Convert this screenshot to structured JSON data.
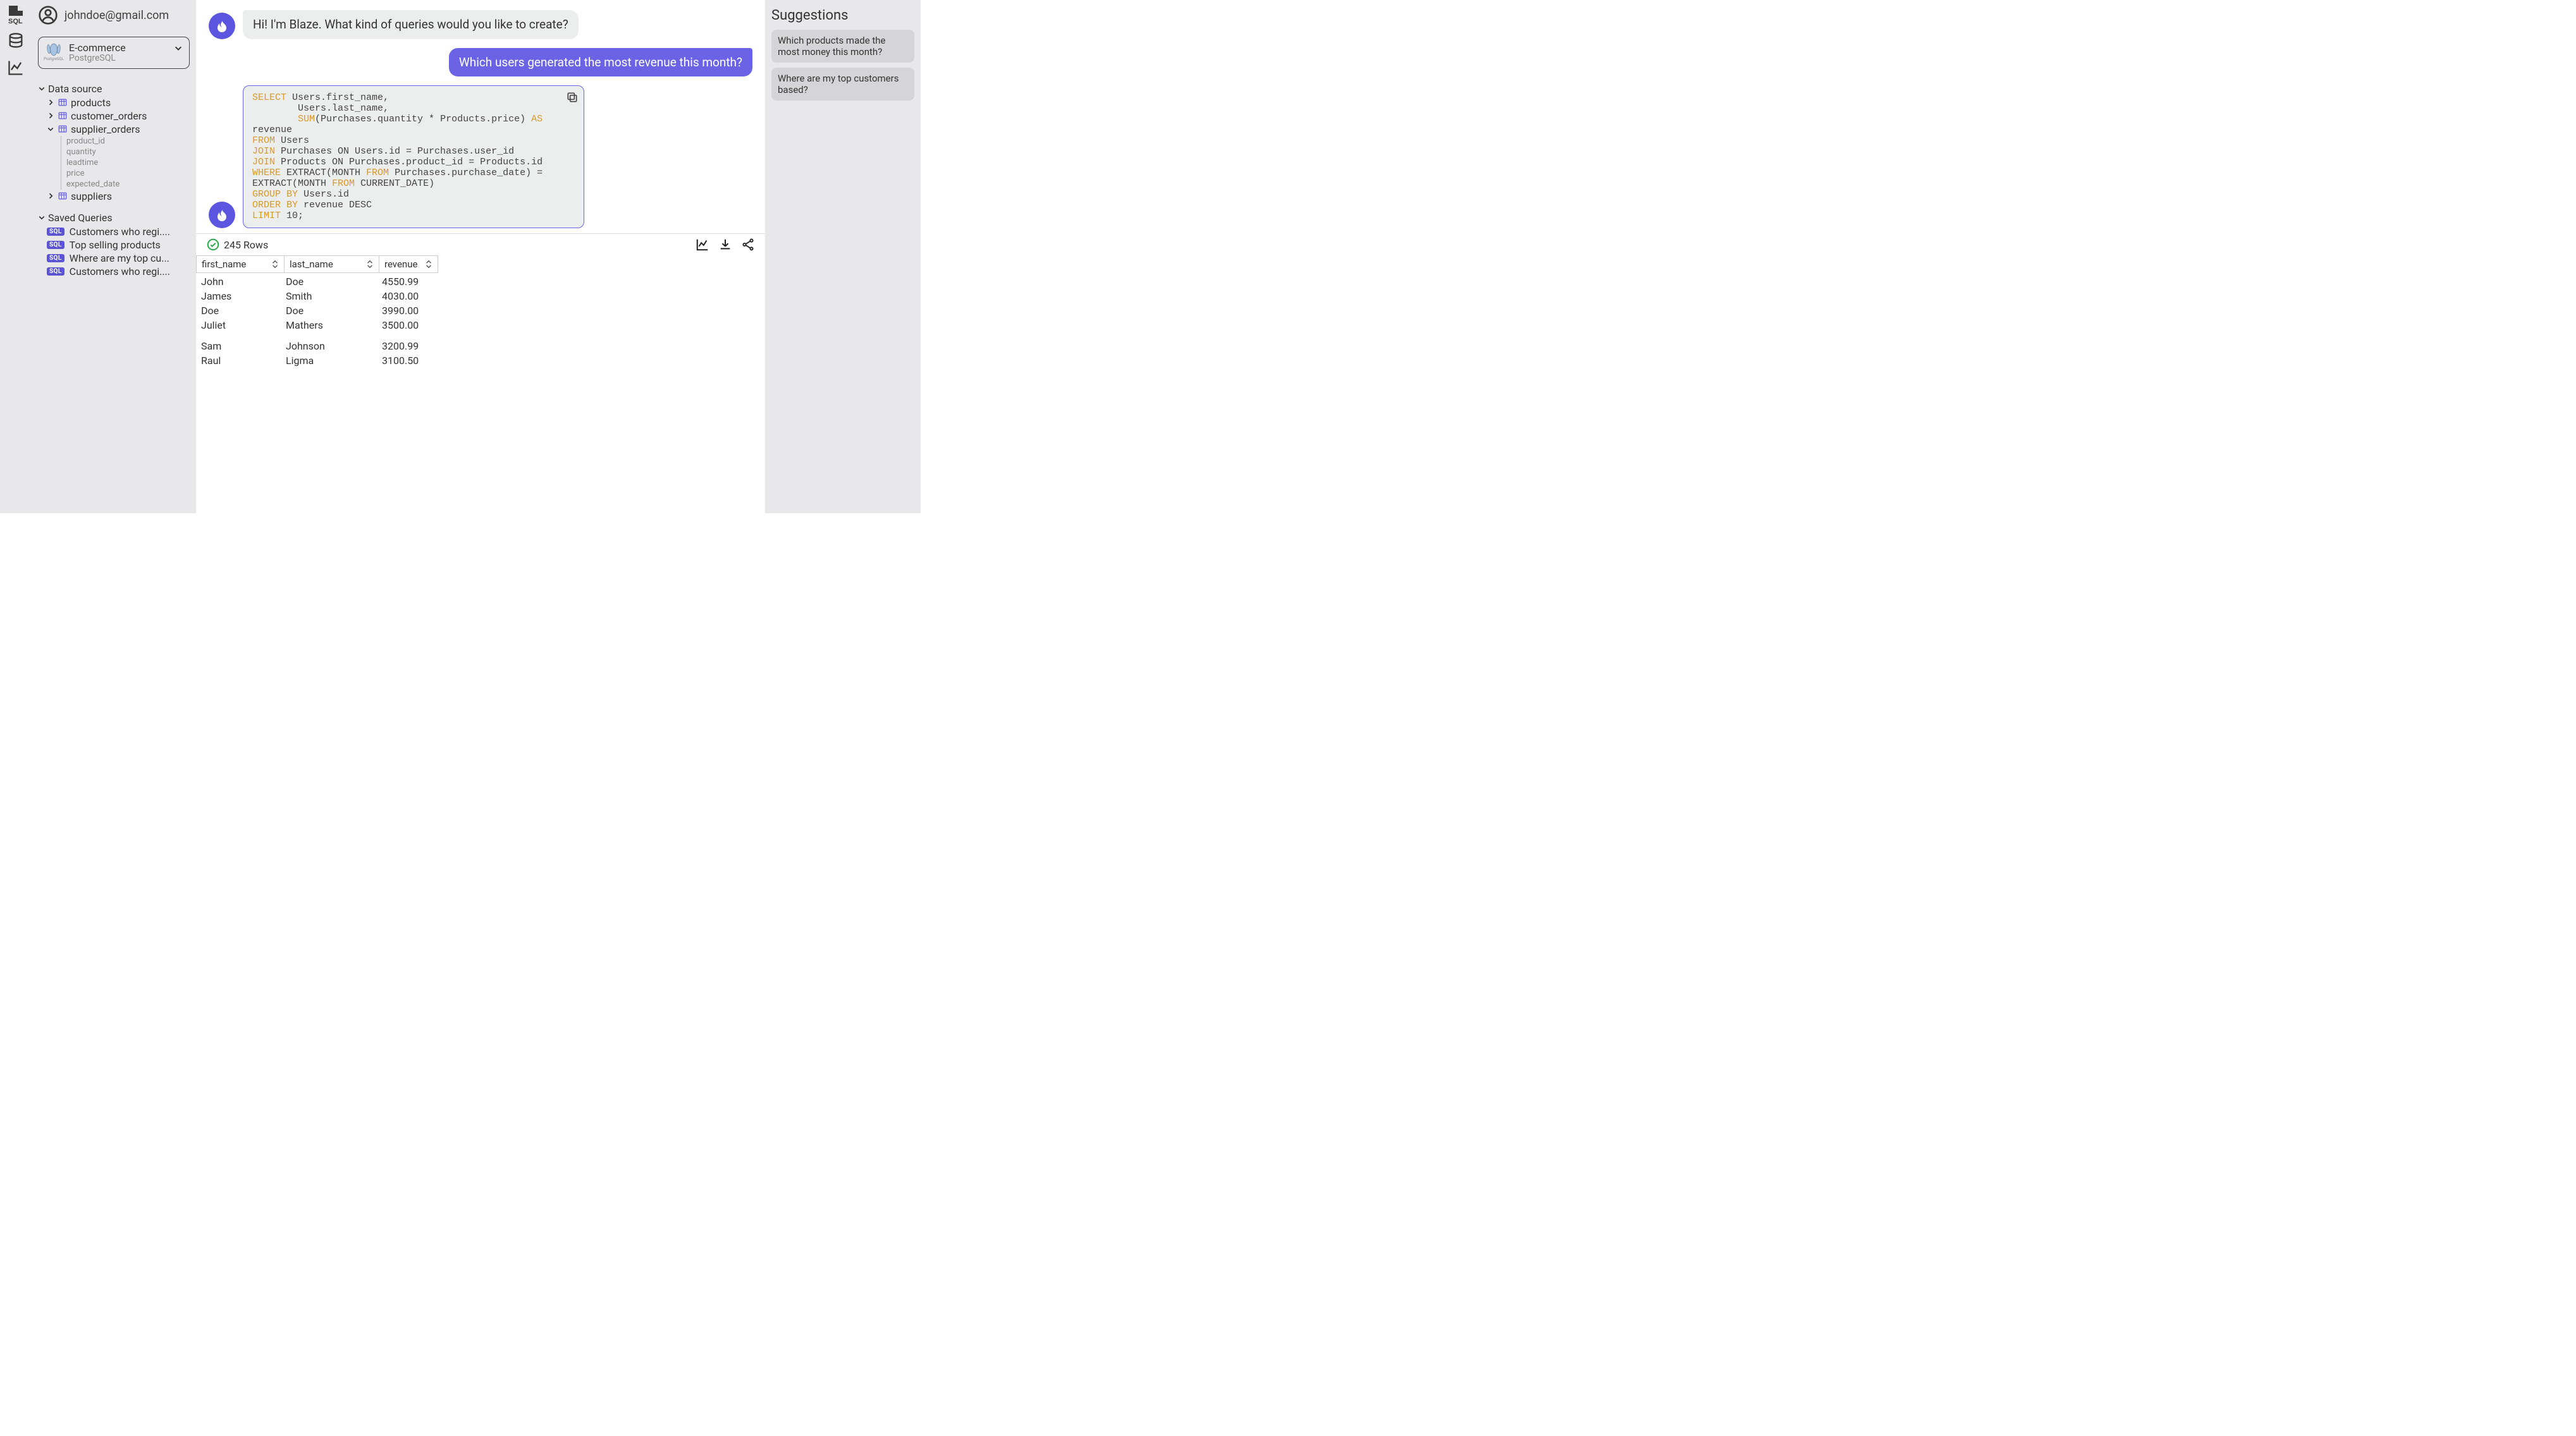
{
  "user": {
    "email": "johndoe@gmail.com"
  },
  "db_selector": {
    "name": "E-commerce",
    "type": "PostgreSQL"
  },
  "sidebar": {
    "data_source_label": "Data source",
    "tables": [
      {
        "name": "products",
        "expanded": false
      },
      {
        "name": "customer_orders",
        "expanded": false
      },
      {
        "name": "supplier_orders",
        "expanded": true,
        "columns": [
          "product_id",
          "quantity",
          "leadtime",
          "price",
          "expected_date"
        ]
      },
      {
        "name": "suppliers",
        "expanded": false
      }
    ],
    "saved_label": "Saved Queries",
    "saved": [
      "Customers who regi....",
      "Top selling products",
      "Where are my top cu...",
      "Customers who regi...."
    ]
  },
  "chat": {
    "assistant_greeting": "Hi! I'm Blaze. What kind of queries would you like to create?",
    "user_message": "Which users generated the most revenue this month?"
  },
  "sql": {
    "tokens": [
      {
        "t": "kw",
        "v": "SELECT"
      },
      {
        "t": "",
        "v": " Users.first_name,\n"
      },
      {
        "t": "",
        "v": "        Users.last_name,\n"
      },
      {
        "t": "",
        "v": "        "
      },
      {
        "t": "kw",
        "v": "SUM"
      },
      {
        "t": "",
        "v": "(Purchases.quantity * Products.price) "
      },
      {
        "t": "kw",
        "v": "AS"
      },
      {
        "t": "",
        "v": " revenue\n"
      },
      {
        "t": "kw",
        "v": "FROM"
      },
      {
        "t": "",
        "v": " Users\n"
      },
      {
        "t": "kw",
        "v": "JOIN"
      },
      {
        "t": "",
        "v": " Purchases ON Users.id = Purchases.user_id\n"
      },
      {
        "t": "kw",
        "v": "JOIN"
      },
      {
        "t": "",
        "v": " Products ON Purchases.product_id = Products.id\n"
      },
      {
        "t": "kw",
        "v": "WHERE"
      },
      {
        "t": "",
        "v": " EXTRACT(MONTH "
      },
      {
        "t": "kw",
        "v": "FROM"
      },
      {
        "t": "",
        "v": " Purchases.purchase_date) = EXTRACT(MONTH "
      },
      {
        "t": "kw",
        "v": "FROM"
      },
      {
        "t": "",
        "v": " CURRENT_DATE)\n"
      },
      {
        "t": "kw",
        "v": "GROUP BY"
      },
      {
        "t": "",
        "v": " Users.id\n"
      },
      {
        "t": "kw",
        "v": "ORDER BY"
      },
      {
        "t": "",
        "v": " revenue DESC\n"
      },
      {
        "t": "kw",
        "v": "LIMIT"
      },
      {
        "t": "",
        "v": " 10;"
      }
    ]
  },
  "results": {
    "status": "245 Rows",
    "columns": [
      "first_name",
      "last_name",
      "revenue"
    ],
    "rows": [
      {
        "first_name": "John",
        "last_name": "Doe",
        "revenue": "4550.99"
      },
      {
        "first_name": "James",
        "last_name": "Smith",
        "revenue": "4030.00"
      },
      {
        "first_name": "Doe",
        "last_name": "Doe",
        "revenue": "3990.00"
      },
      {
        "first_name": "Juliet",
        "last_name": "Mathers",
        "revenue": "3500.00"
      },
      {
        "first_name": "Sam",
        "last_name": "Johnson",
        "revenue": "3200.99"
      },
      {
        "first_name": "Raul",
        "last_name": "Ligma",
        "revenue": "3100.50"
      }
    ],
    "gap_after_index": 3
  },
  "suggestions": {
    "title": "Suggestions",
    "items": [
      "Which products made the most money this month?",
      "Where are my top customers based?"
    ]
  },
  "colors": {
    "accent": "#6a63e6"
  }
}
